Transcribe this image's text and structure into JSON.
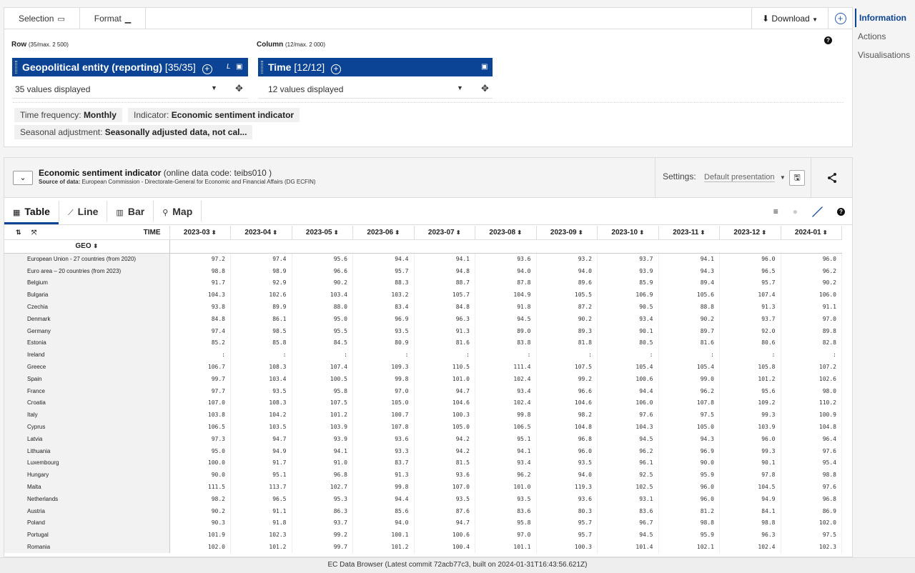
{
  "selection_tabs": {
    "selection": "Selection",
    "format": "Format"
  },
  "download": "Download",
  "sidebar": [
    "Information",
    "Actions",
    "Visualisations"
  ],
  "row_label": {
    "title": "Row",
    "count": "(35/max. 2 500)"
  },
  "column_label": {
    "title": "Column",
    "count": "(12/max. 2 000)"
  },
  "row_dim": {
    "name": "Geopolitical entity (reporting)",
    "count": "[35/35]",
    "values": "35 values displayed"
  },
  "col_dim": {
    "name": "Time",
    "count": "[12/12]",
    "values": "12 values displayed"
  },
  "filters": [
    {
      "label": "Time frequency:",
      "value": "Monthly"
    },
    {
      "label": "Indicator:",
      "value": "Economic sentiment indicator"
    },
    {
      "label": "Seasonal adjustment:",
      "value": "Seasonally adjusted data, not cal..."
    }
  ],
  "dataset": {
    "title": "Economic sentiment indicator",
    "code": "(online data code: teibs010 )",
    "source_label": "Source of data:",
    "source": "European Commission - Directorate-General for Economic and Financial Affairs (DG ECFIN)",
    "settings_label": "Settings:",
    "presentation": "Default presentation"
  },
  "view_tabs": [
    "Table",
    "Line",
    "Bar",
    "Map"
  ],
  "table": {
    "time_header": "TIME",
    "geo_header": "GEO",
    "columns": [
      "2023-03",
      "2023-04",
      "2023-05",
      "2023-06",
      "2023-07",
      "2023-08",
      "2023-09",
      "2023-10",
      "2023-11",
      "2023-12",
      "2024-01"
    ],
    "rows": [
      {
        "geo": "European Union - 27 countries (from 2020)",
        "values": [
          "97.2",
          "97.4",
          "95.6",
          "94.4",
          "94.1",
          "93.6",
          "93.2",
          "93.7",
          "94.1",
          "96.0",
          "96.0"
        ]
      },
      {
        "geo": "Euro area – 20 countries (from 2023)",
        "values": [
          "98.8",
          "98.9",
          "96.6",
          "95.7",
          "94.8",
          "94.0",
          "94.0",
          "93.9",
          "94.3",
          "96.5",
          "96.2"
        ]
      },
      {
        "geo": "Belgium",
        "values": [
          "91.7",
          "92.9",
          "90.2",
          "88.3",
          "88.7",
          "87.8",
          "89.6",
          "85.9",
          "89.4",
          "95.7",
          "90.2"
        ]
      },
      {
        "geo": "Bulgaria",
        "values": [
          "104.3",
          "102.6",
          "103.4",
          "103.2",
          "105.7",
          "104.9",
          "105.5",
          "106.9",
          "105.6",
          "107.4",
          "106.0"
        ]
      },
      {
        "geo": "Czechia",
        "values": [
          "93.8",
          "89.9",
          "88.0",
          "83.4",
          "84.8",
          "91.8",
          "87.2",
          "90.5",
          "88.8",
          "91.3",
          "91.1"
        ]
      },
      {
        "geo": "Denmark",
        "values": [
          "84.8",
          "86.1",
          "95.0",
          "96.9",
          "96.3",
          "94.5",
          "90.2",
          "93.4",
          "90.2",
          "93.7",
          "97.0"
        ]
      },
      {
        "geo": "Germany",
        "values": [
          "97.4",
          "98.5",
          "95.5",
          "93.5",
          "91.3",
          "89.0",
          "89.3",
          "90.1",
          "89.7",
          "92.0",
          "89.8"
        ]
      },
      {
        "geo": "Estonia",
        "values": [
          "85.2",
          "85.8",
          "84.5",
          "80.9",
          "81.6",
          "83.8",
          "81.8",
          "80.5",
          "81.6",
          "80.6",
          "82.8"
        ]
      },
      {
        "geo": "Ireland",
        "values": [
          ":",
          ":",
          ":",
          ":",
          ":",
          ":",
          ":",
          ":",
          ":",
          ":",
          ":"
        ]
      },
      {
        "geo": "Greece",
        "values": [
          "106.7",
          "108.3",
          "107.4",
          "109.3",
          "110.5",
          "111.4",
          "107.5",
          "105.4",
          "105.4",
          "105.8",
          "107.2"
        ]
      },
      {
        "geo": "Spain",
        "values": [
          "99.7",
          "103.4",
          "100.5",
          "99.8",
          "101.0",
          "102.4",
          "99.2",
          "100.6",
          "99.0",
          "101.2",
          "102.6"
        ]
      },
      {
        "geo": "France",
        "values": [
          "97.7",
          "93.5",
          "95.8",
          "97.0",
          "94.7",
          "93.4",
          "96.6",
          "94.4",
          "96.2",
          "95.6",
          "98.0"
        ]
      },
      {
        "geo": "Croatia",
        "values": [
          "107.0",
          "108.3",
          "107.5",
          "105.0",
          "104.6",
          "102.4",
          "104.6",
          "106.0",
          "107.8",
          "109.2",
          "110.2"
        ]
      },
      {
        "geo": "Italy",
        "values": [
          "103.8",
          "104.2",
          "101.2",
          "100.7",
          "100.3",
          "99.8",
          "98.2",
          "97.6",
          "97.5",
          "99.3",
          "100.9"
        ]
      },
      {
        "geo": "Cyprus",
        "values": [
          "106.5",
          "103.5",
          "103.9",
          "107.8",
          "105.0",
          "106.5",
          "104.8",
          "104.3",
          "105.0",
          "103.9",
          "104.8"
        ]
      },
      {
        "geo": "Latvia",
        "values": [
          "97.3",
          "94.7",
          "93.9",
          "93.6",
          "94.2",
          "95.1",
          "96.8",
          "94.5",
          "94.3",
          "96.0",
          "96.4"
        ]
      },
      {
        "geo": "Lithuania",
        "values": [
          "95.0",
          "94.9",
          "94.1",
          "93.3",
          "94.2",
          "94.1",
          "96.0",
          "96.2",
          "96.9",
          "99.3",
          "97.6"
        ]
      },
      {
        "geo": "Luxembourg",
        "values": [
          "100.0",
          "91.7",
          "91.0",
          "83.7",
          "81.5",
          "93.4",
          "93.5",
          "96.1",
          "90.0",
          "90.1",
          "95.4"
        ]
      },
      {
        "geo": "Hungary",
        "values": [
          "90.0",
          "95.1",
          "96.8",
          "91.3",
          "93.6",
          "96.2",
          "94.0",
          "92.5",
          "95.9",
          "97.8",
          "98.8"
        ]
      },
      {
        "geo": "Malta",
        "values": [
          "111.5",
          "113.7",
          "102.7",
          "99.8",
          "107.0",
          "101.0",
          "119.3",
          "102.5",
          "96.0",
          "104.5",
          "97.6"
        ]
      },
      {
        "geo": "Netherlands",
        "values": [
          "98.2",
          "96.5",
          "95.3",
          "94.4",
          "93.5",
          "93.5",
          "93.6",
          "93.1",
          "96.0",
          "94.9",
          "96.8"
        ]
      },
      {
        "geo": "Austria",
        "values": [
          "90.2",
          "91.1",
          "86.3",
          "85.6",
          "87.6",
          "83.6",
          "80.3",
          "83.6",
          "81.2",
          "84.1",
          "86.9"
        ]
      },
      {
        "geo": "Poland",
        "values": [
          "90.3",
          "91.8",
          "93.7",
          "94.0",
          "94.7",
          "95.8",
          "95.7",
          "96.7",
          "98.8",
          "98.8",
          "102.0"
        ]
      },
      {
        "geo": "Portugal",
        "values": [
          "101.9",
          "102.3",
          "99.2",
          "100.1",
          "100.6",
          "97.0",
          "95.7",
          "94.5",
          "95.9",
          "96.3",
          "97.5"
        ]
      },
      {
        "geo": "Romania",
        "values": [
          "102.0",
          "101.2",
          "99.7",
          "101.2",
          "100.4",
          "101.1",
          "100.3",
          "101.4",
          "102.1",
          "102.4",
          "102.3"
        ]
      }
    ]
  },
  "footer": "EC Data Browser (Latest commit 72acb77c3, built on 2024-01-31T16:43:56.621Z)"
}
